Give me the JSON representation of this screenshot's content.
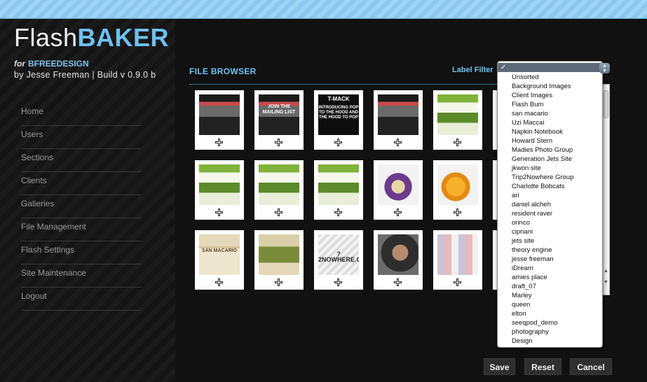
{
  "brand": {
    "prefix": "Flash",
    "name": "BAKER",
    "for": "for",
    "client": "BFREEDESIGN",
    "byline": "by Jesse Freeman | Build v 0.9.0 b"
  },
  "nav": [
    "Home",
    "Users",
    "Sections",
    "Clients",
    "Galleries",
    "File Management",
    "Flash Settings",
    "Site Maintenance",
    "Logout"
  ],
  "file_browser": {
    "title": "FILE BROWSER",
    "filter_label": "Label Filter"
  },
  "thumb_texts": {
    "t2": "JOIN THE MAILING LIST",
    "t3a": "T-MACK",
    "t3b": "INTRODUCING POP TO THE HOOD AND THE HOOD TO POP",
    "t12": "SAN MACARIO",
    "t13": "?2NOWHERE.C"
  },
  "filter": {
    "selected": "✓",
    "options": [
      "Unsorted",
      "Background Images",
      "Client Images",
      "Flash Bum",
      "san macario",
      "Uzi Maccai",
      "Napkin Notebook",
      "Howard Stern",
      "Madies Photo Group",
      "Generation Jets Site",
      "jkwon site",
      "Trip2Nowhere Group",
      "Charlotte Bobcats",
      "ari",
      "daniel alcheh",
      "resident raver",
      "orinco",
      "cipriani",
      "jets site",
      "theory engine",
      "jesse freeman",
      "iDream",
      "amies place",
      "draft_07",
      "Marley",
      "queen",
      "elton",
      "seeqpod_demo",
      "photography",
      "Design"
    ]
  },
  "buttons": {
    "save": "Save",
    "reset": "Reset",
    "cancel": "Cancel"
  }
}
